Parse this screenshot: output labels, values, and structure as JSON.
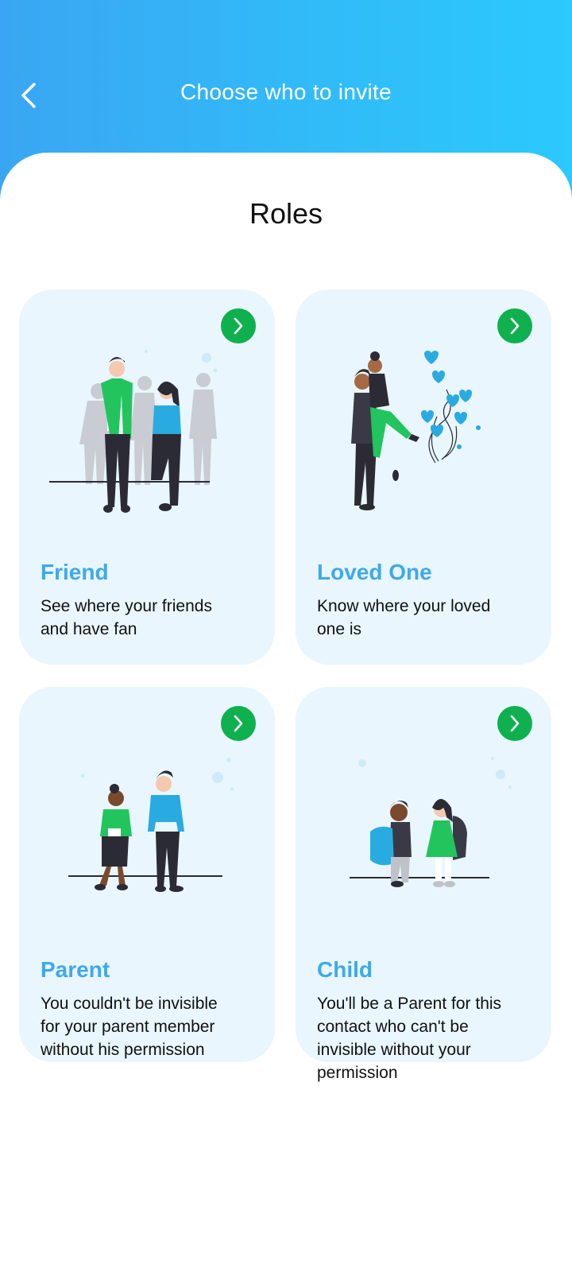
{
  "header": {
    "title": "Choose who to invite",
    "back_icon": "chevron-left-icon"
  },
  "section": {
    "title": "Roles"
  },
  "roles": [
    {
      "title": "Friend",
      "description": "See where your friends\nand have fan",
      "action_icon": "chevron-right-icon"
    },
    {
      "title": "Loved One",
      "description": "Know where your loved\none is",
      "action_icon": "chevron-right-icon"
    },
    {
      "title": "Parent",
      "description": "You couldn't be invisible\nfor  your parent member\nwithout his permission",
      "action_icon": "chevron-right-icon"
    },
    {
      "title": "Child",
      "description": "You'll be a Parent for this\ncontact who can't be\ninvisible without your\npermission",
      "action_icon": "chevron-right-icon"
    }
  ],
  "colors": {
    "header_gradient_start": "#3aa6f3",
    "header_gradient_end": "#2bc9fd",
    "card_background": "#e9f6fd",
    "card_title": "#3ea9ec",
    "action_button": "#0fb04e",
    "illustration_green": "#22c45e",
    "illustration_blue": "#29abe2"
  }
}
